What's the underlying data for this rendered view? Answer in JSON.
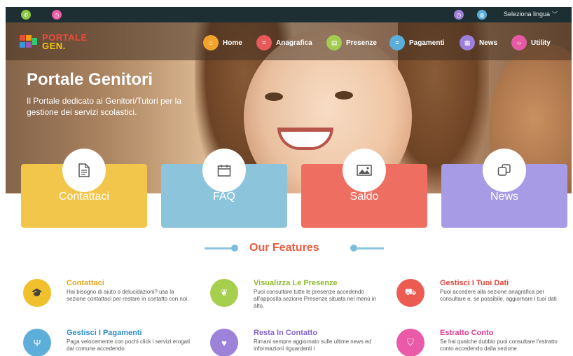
{
  "topbar": {
    "language_label": "Seleziona lingua",
    "language_chevron": "﹀"
  },
  "logo": {
    "line1": "PORTALE",
    "line2": "GEN."
  },
  "nav": [
    {
      "label": "Home",
      "color": "#f0a42c",
      "icon": "home-icon",
      "glyph": "⌂"
    },
    {
      "label": "Anagrafica",
      "color": "#e85a5a",
      "icon": "list-icon",
      "glyph": "≡"
    },
    {
      "label": "Presenze",
      "color": "#a3cb4f",
      "icon": "document-icon",
      "glyph": "▤"
    },
    {
      "label": "Pagamenti",
      "color": "#5aaed9",
      "icon": "list-icon",
      "glyph": "≡"
    },
    {
      "label": "News",
      "color": "#9b7fd8",
      "icon": "calendar-icon",
      "glyph": "▦"
    },
    {
      "label": "Utility",
      "color": "#e65aa5",
      "icon": "code-icon",
      "glyph": "‹›"
    }
  ],
  "hero": {
    "title": "Portale Genitori",
    "subtitle": "Il Portale dedicato ai Genitori/Tutori per la gestione dei servizi scolastici."
  },
  "cards": [
    {
      "label": "Contattaci",
      "color": "#f2c64a",
      "icon": "document-icon"
    },
    {
      "label": "FAQ",
      "color": "#8cc4dc",
      "icon": "calendar-icon"
    },
    {
      "label": "Saldo",
      "color": "#ee6f62",
      "icon": "image-icon"
    },
    {
      "label": "News",
      "color": "#a89be6",
      "icon": "copy-icon"
    }
  ],
  "features": {
    "title": "Our Features",
    "items": [
      {
        "title": "Contattaci",
        "text": "Hai bisogno di aiuto o delucidazioni? usa la sezione contattaci per restare in contatto con noi.",
        "color": "#f0c02d",
        "title_color": "#e9a51b",
        "icon": "graduation-cap-icon",
        "glyph": "🎓"
      },
      {
        "title": "Visualizza Le Presenze",
        "text": "Puoi consultare tutte le presenze accedendo all'apposita sezione Presenze situata nel menù in alto.",
        "color": "#a6cf4d",
        "title_color": "#8dbb2c",
        "icon": "leaf-icon",
        "glyph": "❦"
      },
      {
        "title": "Gestisci I Tuoi Dati",
        "text": "Puoi accedere alla sezione anagrafica per consultare e, se possibile, aggiornare i tuoi dati",
        "color": "#ec5b52",
        "title_color": "#e0453a",
        "icon": "car-icon",
        "glyph": "⛟"
      },
      {
        "title": "Gestisci I Pagamenti",
        "text": "Paga velocemente con pochi click i servizi erogati dal comune accedendo",
        "color": "#5eaedc",
        "title_color": "#2f8fc9",
        "icon": "cutlery-icon",
        "glyph": "Ψ"
      },
      {
        "title": "Resta In Contatto",
        "text": "Rimani sempre aggiornato sulle ultime news ed informazioni riguardanti i",
        "color": "#9c82d9",
        "title_color": "#8466cc",
        "icon": "heart-icon",
        "glyph": "♥"
      },
      {
        "title": "Estratto Conto",
        "text": "Se hai qualche dubbio puoi consultare l'estratto conto accedendo dalla sezione",
        "color": "#ea5aa8",
        "title_color": "#dd3c90",
        "icon": "shield-icon",
        "glyph": "⛉"
      }
    ]
  }
}
